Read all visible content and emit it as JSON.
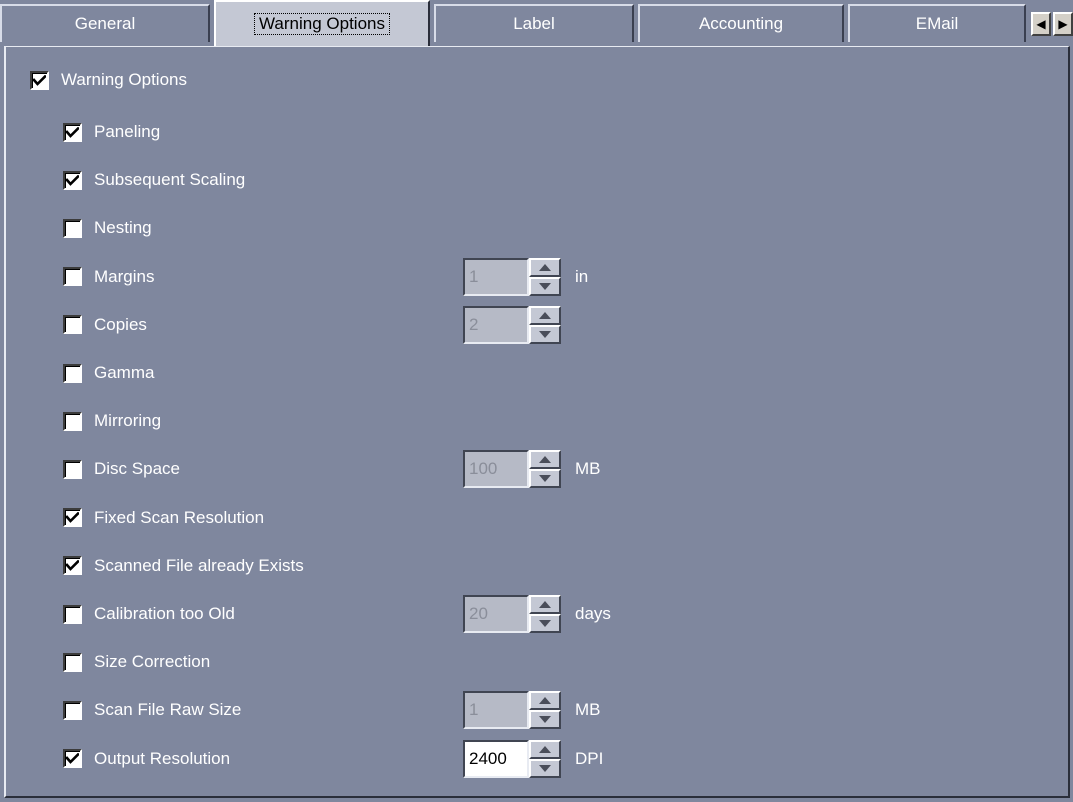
{
  "tabs": [
    {
      "label": "General",
      "active": false
    },
    {
      "label": "Warning Options",
      "active": true
    },
    {
      "label": "Label",
      "active": false
    },
    {
      "label": "Accounting",
      "active": false
    },
    {
      "label": "EMail",
      "active": false
    }
  ],
  "tab_scroll": {
    "left_icon": "◀",
    "right_icon": "▶"
  },
  "master": {
    "label": "Warning Options",
    "checked": true
  },
  "options": [
    {
      "label": "Paneling",
      "checked": true
    },
    {
      "label": "Subsequent Scaling",
      "checked": true
    },
    {
      "label": "Nesting",
      "checked": false
    },
    {
      "label": "Margins",
      "checked": false,
      "spinner": {
        "value": "1",
        "unit": "in",
        "enabled": false
      }
    },
    {
      "label": "Copies",
      "checked": false,
      "spinner": {
        "value": "2",
        "unit": "",
        "enabled": false
      }
    },
    {
      "label": "Gamma",
      "checked": false
    },
    {
      "label": "Mirroring",
      "checked": false
    },
    {
      "label": "Disc Space",
      "checked": false,
      "spinner": {
        "value": "100",
        "unit": "MB",
        "enabled": false
      }
    },
    {
      "label": "Fixed Scan Resolution",
      "checked": true
    },
    {
      "label": "Scanned File already Exists",
      "checked": true
    },
    {
      "label": "Calibration too Old",
      "checked": false,
      "spinner": {
        "value": "20",
        "unit": "days",
        "enabled": false
      }
    },
    {
      "label": "Size Correction",
      "checked": false
    },
    {
      "label": "Scan File Raw Size",
      "checked": false,
      "spinner": {
        "value": "1",
        "unit": "MB",
        "enabled": false
      }
    },
    {
      "label": "Output Resolution",
      "checked": true,
      "spinner": {
        "value": "2400",
        "unit": "DPI",
        "enabled": true
      }
    }
  ],
  "colors": {
    "background": "#7f879e",
    "active_tab": "#c4c8d4",
    "text": "#ffffff"
  }
}
